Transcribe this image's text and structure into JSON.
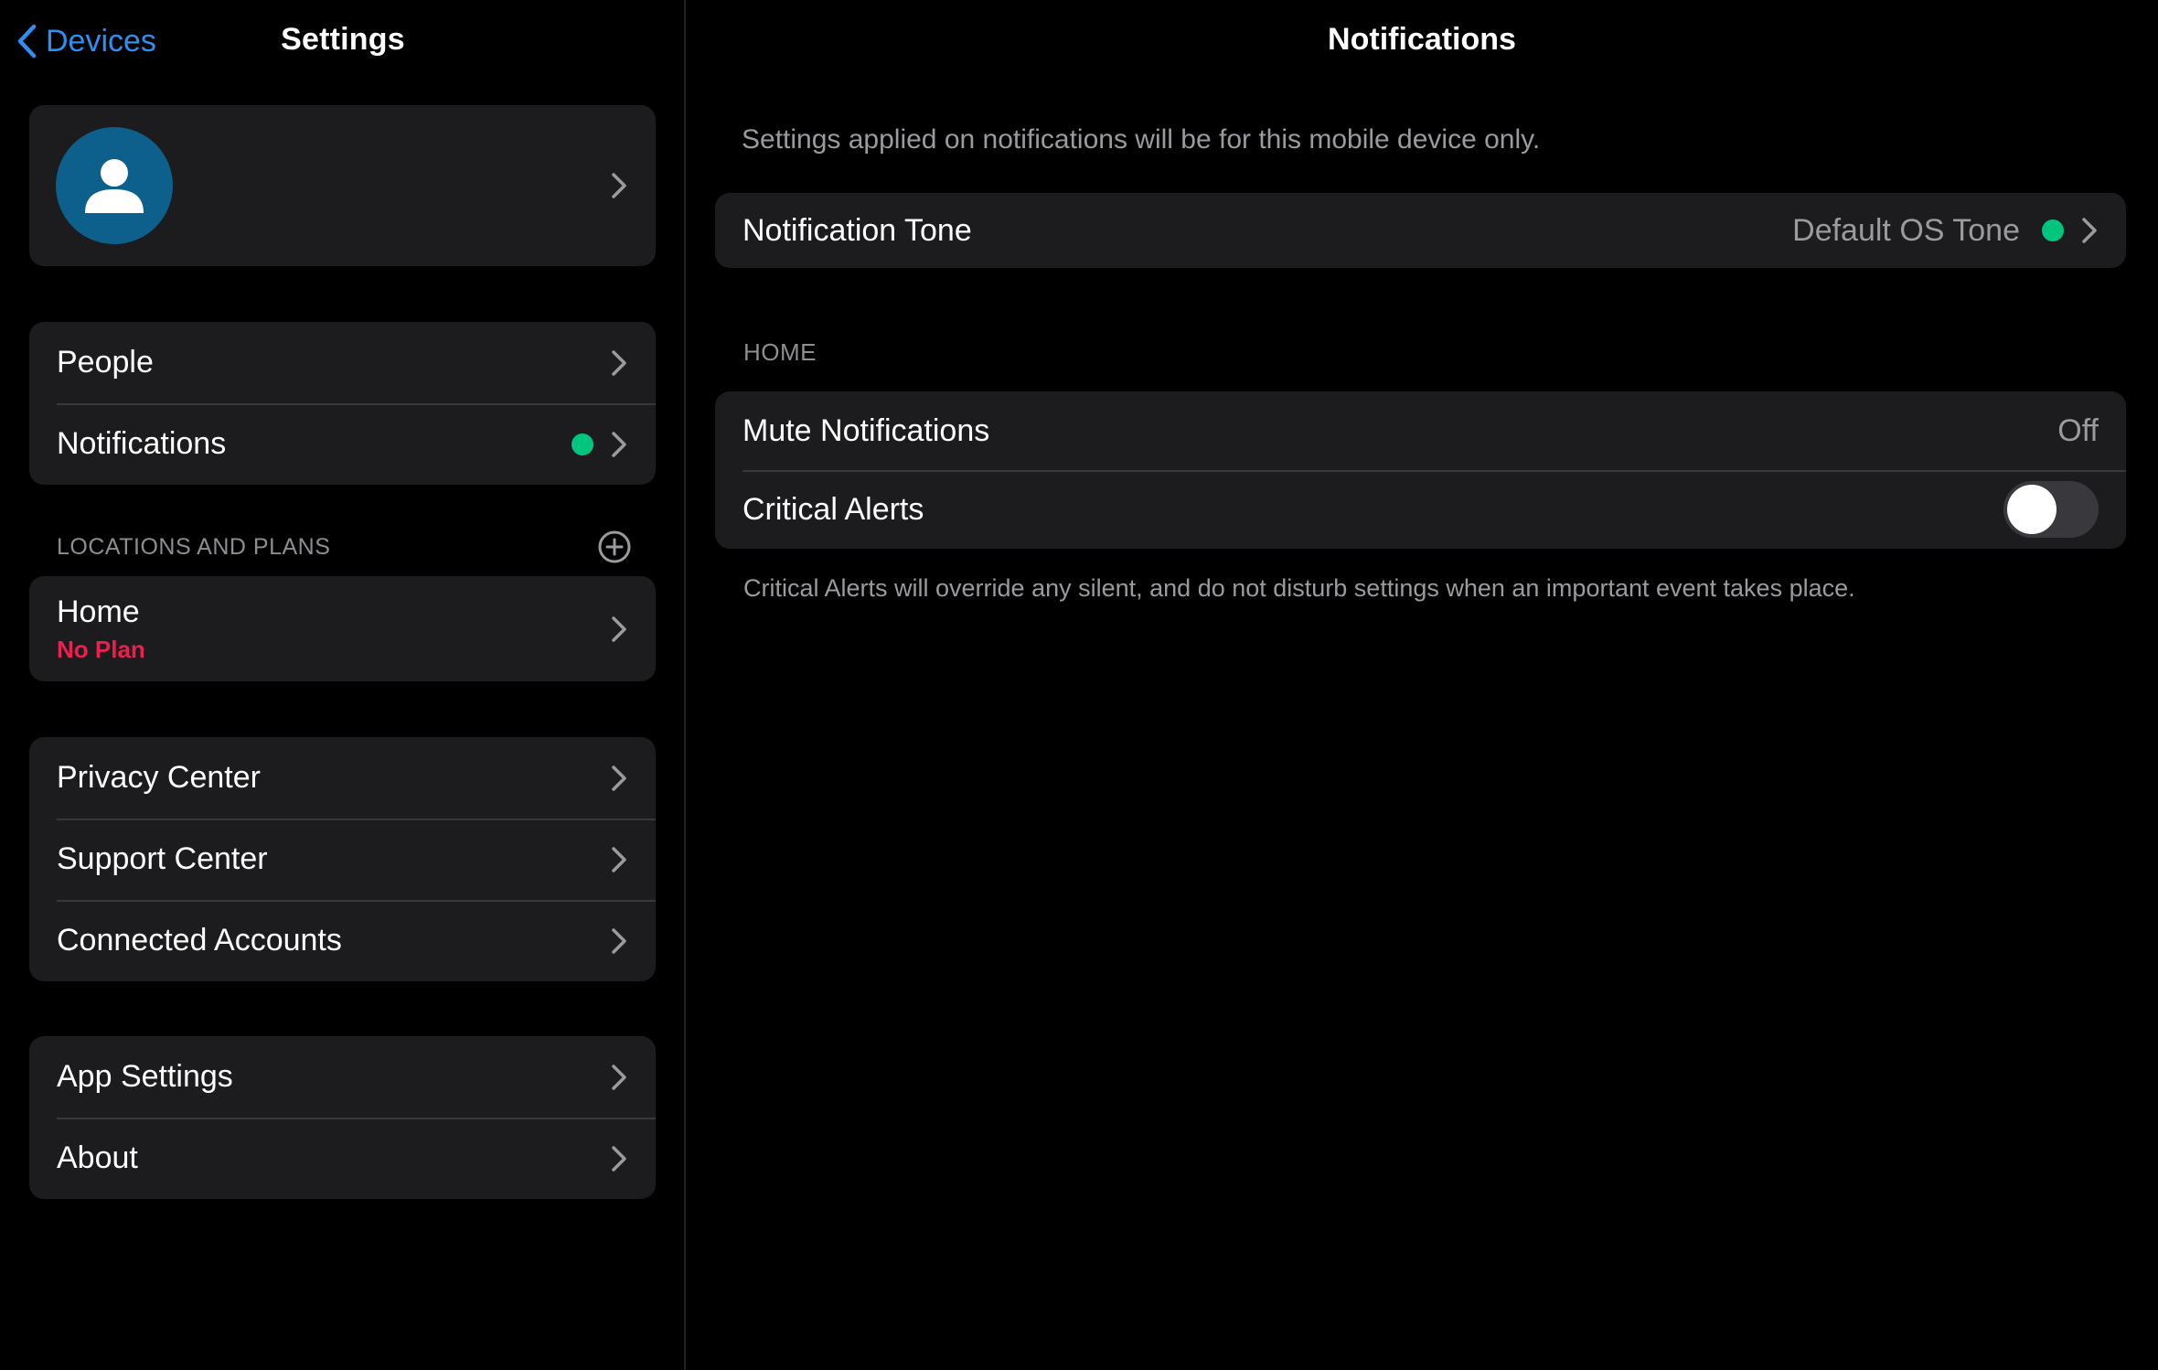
{
  "colors": {
    "accent": "#2f8ff0",
    "status_green": "#00c57d",
    "no_plan_red": "#e8214f",
    "avatar_bg": "#0d5f8c"
  },
  "sidebar": {
    "back_label": "Devices",
    "title": "Settings",
    "profile": {
      "avatar_icon": "person-icon"
    },
    "group1": [
      {
        "label": "People"
      },
      {
        "label": "Notifications",
        "status": "green-dot"
      }
    ],
    "locations_header": "LOCATIONS AND PLANS",
    "location": {
      "name": "Home",
      "plan": "No Plan"
    },
    "group2": [
      {
        "label": "Privacy Center"
      },
      {
        "label": "Support Center"
      },
      {
        "label": "Connected Accounts"
      }
    ],
    "group3": [
      {
        "label": "App Settings"
      },
      {
        "label": "About"
      }
    ]
  },
  "detail": {
    "title": "Notifications",
    "description": "Settings applied on notifications will be for this mobile device only.",
    "tone": {
      "label": "Notification Tone",
      "value": "Default OS Tone"
    },
    "home_header": "HOME",
    "mute": {
      "label": "Mute Notifications",
      "value": "Off"
    },
    "critical": {
      "label": "Critical Alerts",
      "enabled": false
    },
    "footnote": "Critical Alerts will override any silent, and do not disturb settings when an important event takes place."
  }
}
